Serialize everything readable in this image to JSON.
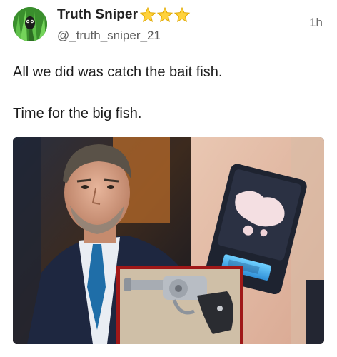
{
  "post": {
    "author": {
      "display_name": "Truth Sniper",
      "handle": "@_truth_sniper_21",
      "badge_stars": 3,
      "badge_color": "#f5c518"
    },
    "timestamp": "1h",
    "text_lines": [
      "All we did was catch the bait fish.",
      "Time for the big fish."
    ],
    "media": {
      "panels": [
        "portrait-photo",
        "scale-photo",
        "revolver-inset-photo"
      ],
      "inset_border_color": "#a01818"
    }
  }
}
